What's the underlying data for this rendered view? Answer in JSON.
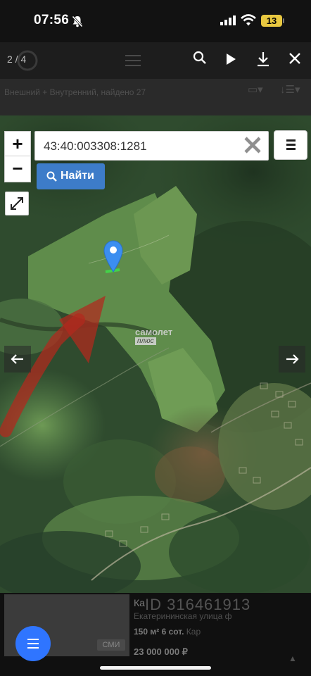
{
  "status_bar": {
    "time": "07:56",
    "battery": "13"
  },
  "viewer": {
    "counter": "2 / 4"
  },
  "background_list": {
    "found_text": "Внешний + Внутренний, найдено 27",
    "card": {
      "title": "Ка",
      "address": "Екатерининская улица ф",
      "area": "150 м² 6 сот.",
      "area_extra": "Кар",
      "price": "23 000 000 ₽",
      "badge": "СМИ"
    }
  },
  "map": {
    "search": {
      "value": "43:40:003308:1281"
    },
    "find_label": "Найти",
    "zoom_in": "+",
    "zoom_out": "−",
    "watermark": "самолет",
    "watermark_sub": "плюс"
  },
  "watermark": {
    "id_text": "ID 316461913"
  },
  "colors": {
    "accent": "#3d7cc9",
    "fab": "#2f75ff",
    "battery": "#e8c840",
    "marker": "#3b8ef0",
    "annotation": "#c0301f"
  },
  "icons": [
    "bell-slash-icon",
    "signal-icon",
    "wifi-icon",
    "battery-icon",
    "search-icon",
    "play-icon",
    "download-icon",
    "close-icon",
    "clear-icon",
    "menu-icon",
    "expand-icon",
    "location-pin-icon",
    "arrow-left-icon",
    "arrow-right-icon"
  ]
}
